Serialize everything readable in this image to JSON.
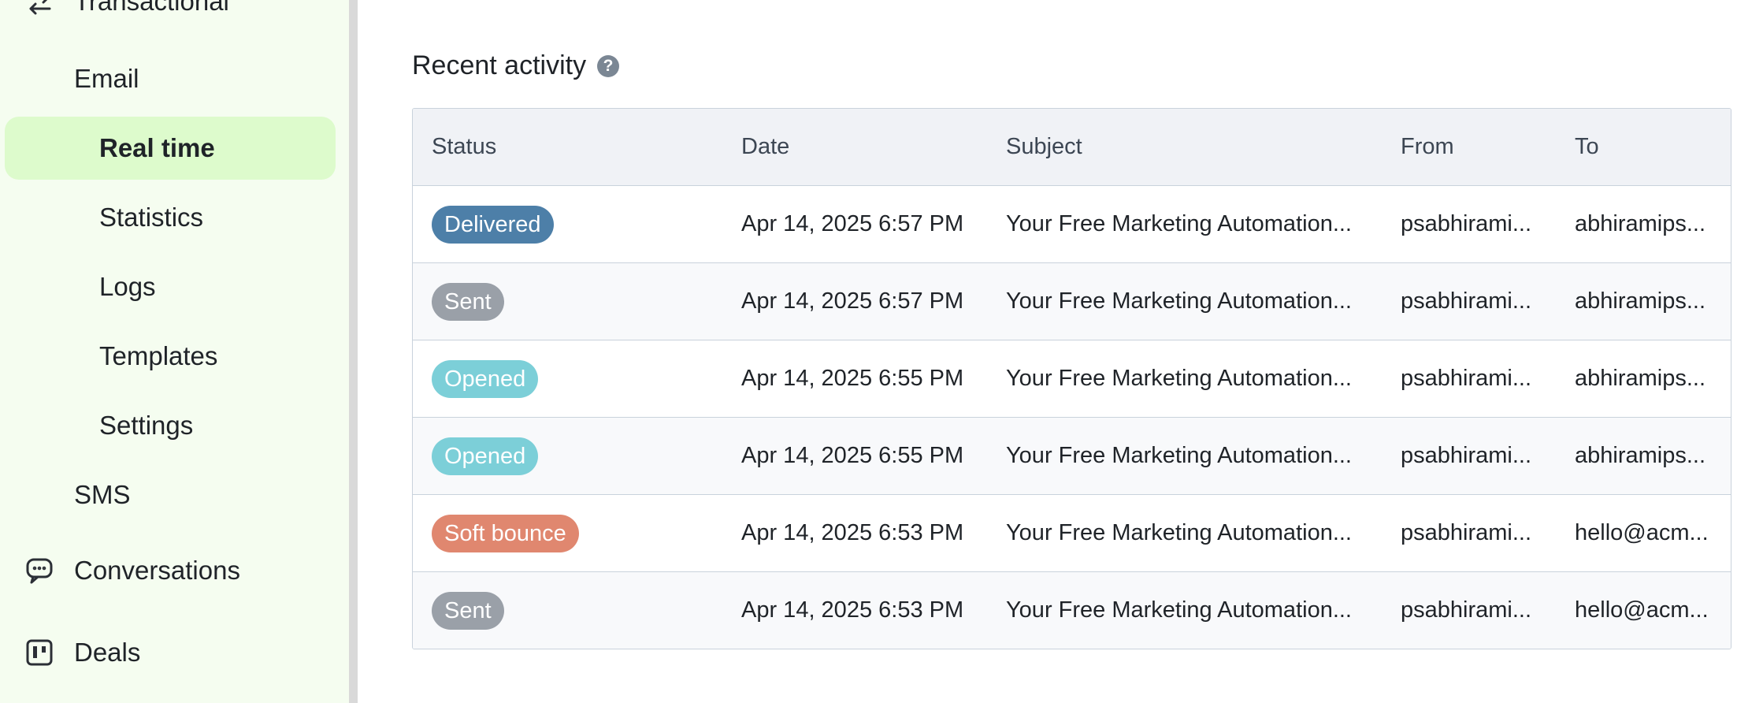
{
  "sidebar": {
    "items": [
      {
        "label": "Transactional",
        "icon": "transfer-arrows-icon"
      },
      {
        "label": "Email"
      },
      {
        "label": "Real time",
        "active": true
      },
      {
        "label": "Statistics"
      },
      {
        "label": "Logs"
      },
      {
        "label": "Templates"
      },
      {
        "label": "Settings"
      },
      {
        "label": "SMS"
      },
      {
        "label": "Conversations",
        "icon": "chat-bubble-icon"
      },
      {
        "label": "Deals",
        "icon": "kanban-board-icon"
      }
    ],
    "active_color": "#ddfbcc",
    "background": "#f5fdf0"
  },
  "main": {
    "title": "Recent activity",
    "help_icon": "?",
    "table": {
      "columns": [
        "Status",
        "Date",
        "Subject",
        "From",
        "To"
      ],
      "rows": [
        {
          "status": "Delivered",
          "status_color": "#4d7fa8",
          "date": "Apr 14, 2025 6:57 PM",
          "subject": "Your Free Marketing Automation...",
          "from": "psabhirami...",
          "to": "abhiramips..."
        },
        {
          "status": "Sent",
          "status_color": "#9aa0a8",
          "date": "Apr 14, 2025 6:57 PM",
          "subject": "Your Free Marketing Automation...",
          "from": "psabhirami...",
          "to": "abhiramips..."
        },
        {
          "status": "Opened",
          "status_color": "#7ccfd8",
          "date": "Apr 14, 2025 6:55 PM",
          "subject": "Your Free Marketing Automation...",
          "from": "psabhirami...",
          "to": "abhiramips..."
        },
        {
          "status": "Opened",
          "status_color": "#7ccfd8",
          "date": "Apr 14, 2025 6:55 PM",
          "subject": "Your Free Marketing Automation...",
          "from": "psabhirami...",
          "to": "abhiramips..."
        },
        {
          "status": "Soft bounce",
          "status_color": "#e0876f",
          "date": "Apr 14, 2025 6:53 PM",
          "subject": "Your Free Marketing Automation...",
          "from": "psabhirami...",
          "to": "hello@acm..."
        },
        {
          "status": "Sent",
          "status_color": "#9aa0a8",
          "date": "Apr 14, 2025 6:53 PM",
          "subject": "Your Free Marketing Automation...",
          "from": "psabhirami...",
          "to": "hello@acm..."
        }
      ]
    }
  }
}
